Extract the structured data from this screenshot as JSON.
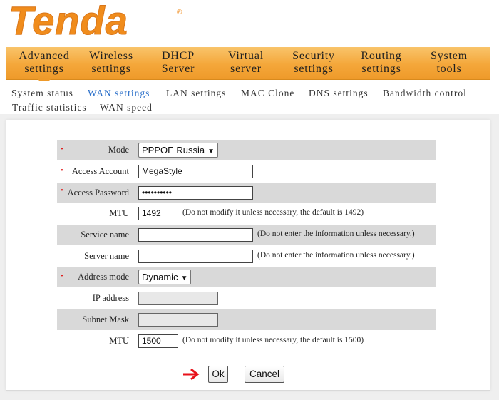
{
  "brand": {
    "logo_text": "Tenda",
    "trademark": "®"
  },
  "top_nav": [
    {
      "line1": "Advanced",
      "line2": "settings"
    },
    {
      "line1": "Wireless",
      "line2": "settings"
    },
    {
      "line1": "DHCP",
      "line2": "Server"
    },
    {
      "line1": "Virtual",
      "line2": "server"
    },
    {
      "line1": "Security",
      "line2": "settings"
    },
    {
      "line1": "Routing",
      "line2": "settings"
    },
    {
      "line1": "System",
      "line2": "tools"
    }
  ],
  "sub_nav": {
    "items": [
      "System status",
      "WAN settings",
      "LAN settings",
      "MAC Clone",
      "DNS settings",
      "Bandwidth control",
      "Traffic statistics",
      "WAN speed"
    ],
    "active": "WAN settings"
  },
  "form": {
    "mode": {
      "label": "Mode",
      "value": "PPPOE Russia",
      "required": "•"
    },
    "access_account": {
      "label": "Access Account",
      "value": "MegaStyle",
      "required": "•"
    },
    "access_password": {
      "label": "Access Password",
      "value": "••••••••••",
      "required": "•"
    },
    "mtu1": {
      "label": "MTU",
      "value": "1492",
      "hint": "(Do not modify it unless necessary, the default is 1492)"
    },
    "service_name": {
      "label": "Service name",
      "value": "",
      "hint": "(Do not enter the information unless necessary.)"
    },
    "server_name": {
      "label": "Server name",
      "value": "",
      "hint": "(Do not enter the information unless necessary.)"
    },
    "address_mode": {
      "label": "Address mode",
      "value": "Dynamic",
      "required": "•"
    },
    "ip_address": {
      "label": "IP address",
      "value": ""
    },
    "subnet_mask": {
      "label": "Subnet Mask",
      "value": ""
    },
    "mtu2": {
      "label": "MTU",
      "value": "1500",
      "hint": "(Do not modify it unless necessary, the default is 1500)"
    }
  },
  "buttons": {
    "ok": "Ok",
    "cancel": "Cancel"
  },
  "colors": {
    "brand_orange": "#f08c1c",
    "nav_orange": "#f4a73a",
    "active_link": "#2a6fc9",
    "required_marker": "#e02020",
    "arrow_red": "#e8121a"
  }
}
